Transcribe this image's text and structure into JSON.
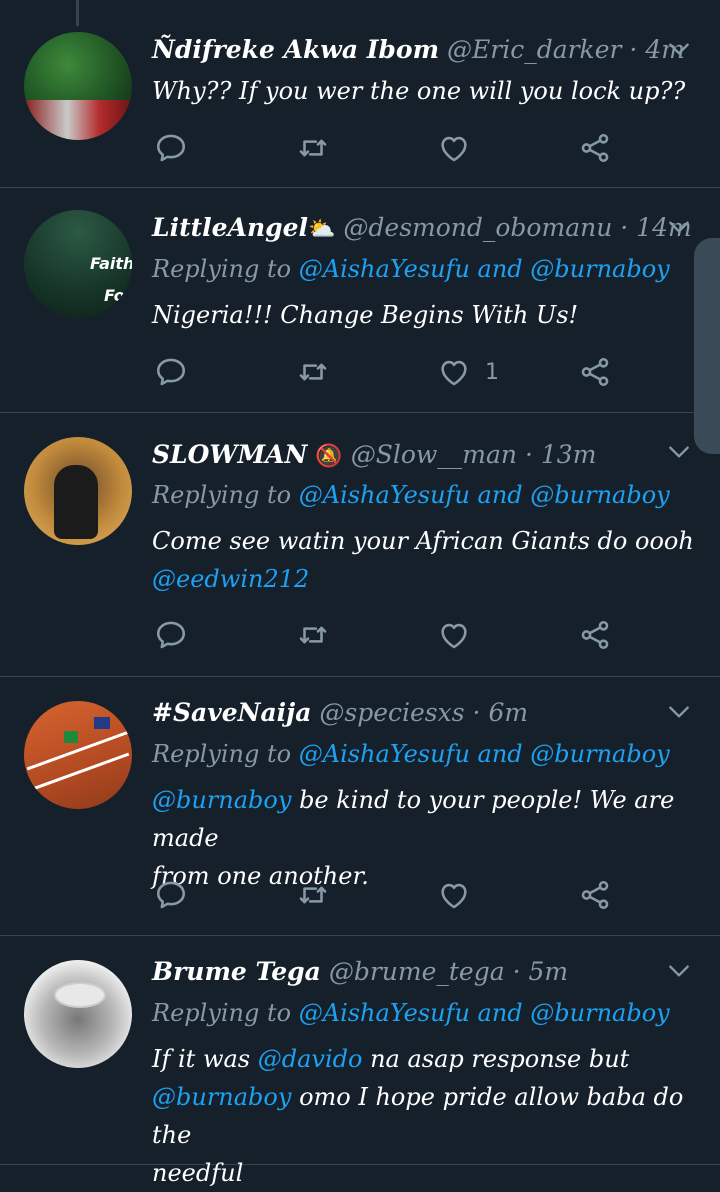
{
  "tweets": [
    {
      "name": "Ñdifreke Akwa Ibom",
      "handle": "@Eric_darker",
      "time": "4m",
      "text": "Why?? If you wer the one will you lock up??",
      "like_count": ""
    },
    {
      "name": "LittleAngel",
      "emoji": "⛅",
      "handle": "@desmond_obomanu",
      "time": "14m",
      "reply_prefix": "Replying to",
      "reply_links": "@AishaYesufu and @burnaboy",
      "text": "Nigeria!!! Change Begins With Us!",
      "avatar_text_1": "Faith",
      "avatar_text_2": "Fo",
      "like_count": "1"
    },
    {
      "name": "SLOWMAN",
      "emoji": "🔕",
      "handle": "@Slow__man",
      "time": "13m",
      "reply_prefix": "Replying to",
      "reply_links": "@AishaYesufu and @burnaboy",
      "text_line1": "Come see watin your African Giants do oooh",
      "text_mention": "@eedwin212",
      "like_count": ""
    },
    {
      "name": "#SaveNaija",
      "handle": "@speciesxs",
      "time": "6m",
      "reply_prefix": "Replying to",
      "reply_links": "@AishaYesufu and @burnaboy",
      "text_mention": "@burnaboy",
      "text_rest_1": " be kind to your people! We are made",
      "text_rest_2": "from one another.",
      "like_count": ""
    },
    {
      "name": "Brume Tega",
      "handle": "@brume_tega",
      "time": "5m",
      "reply_prefix": "Replying to",
      "reply_links": "@AishaYesufu and @burnaboy",
      "text_a": "If it was ",
      "text_mention_a": "@davido",
      "text_b": " na asap response but",
      "text_mention_b": "@burnaboy",
      "text_c": "  omo I hope pride allow baba do the",
      "text_d": "needful",
      "like_count": ""
    }
  ],
  "colors": {
    "background": "#15202b",
    "link": "#1da1f2",
    "muted": "#8899a6",
    "divider": "#38444d"
  },
  "icons": [
    "reply-icon",
    "retweet-icon",
    "like-icon",
    "share-icon",
    "chevron-down-icon"
  ]
}
